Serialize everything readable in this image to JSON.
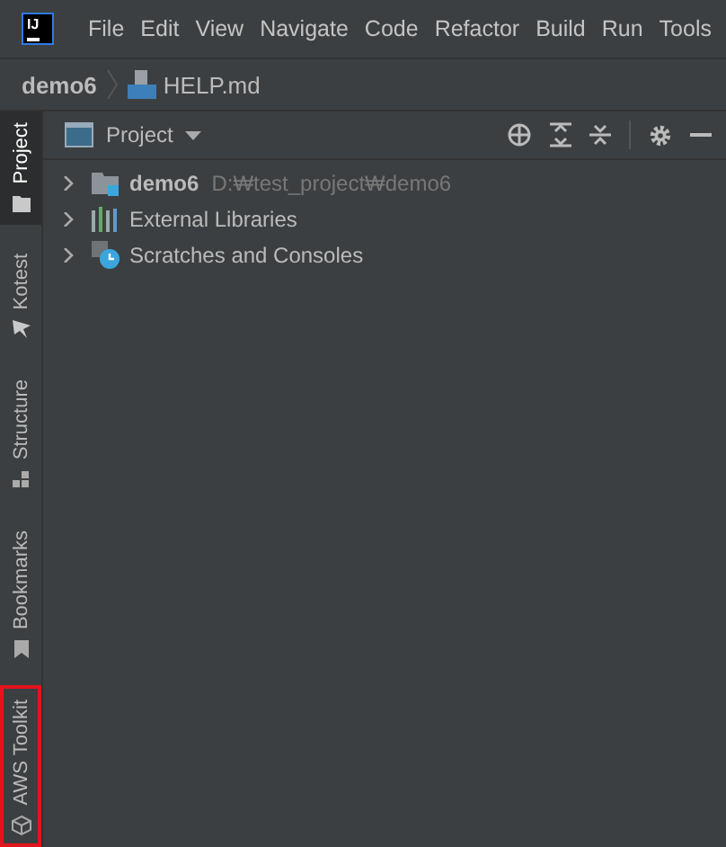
{
  "menu_bar": {
    "logo": "IJ",
    "items": [
      "File",
      "Edit",
      "View",
      "Navigate",
      "Code",
      "Refactor",
      "Build",
      "Run",
      "Tools"
    ]
  },
  "breadcrumb": {
    "items": [
      {
        "label": "demo6",
        "kind": "project"
      },
      {
        "label": "HELP.md",
        "kind": "markdown"
      }
    ]
  },
  "side_tabs": [
    {
      "label": "Project",
      "kind": "folder",
      "selected": true,
      "highlighted": false
    },
    {
      "label": "Kotest",
      "kind": "kotest",
      "selected": false,
      "highlighted": false
    },
    {
      "label": "Structure",
      "kind": "structure",
      "selected": false,
      "highlighted": false
    },
    {
      "label": "Bookmarks",
      "kind": "bookmark",
      "selected": false,
      "highlighted": false
    },
    {
      "label": "AWS Toolkit",
      "kind": "cube",
      "selected": false,
      "highlighted": true
    }
  ],
  "project_panel": {
    "title": "Project",
    "tree": [
      {
        "label": "demo6",
        "path": "D:₩test_project₩demo6",
        "kind": "module",
        "expanded": false
      },
      {
        "label": "External Libraries",
        "kind": "libraries",
        "expanded": false
      },
      {
        "label": "Scratches and Consoles",
        "kind": "scratches",
        "expanded": false
      }
    ]
  }
}
